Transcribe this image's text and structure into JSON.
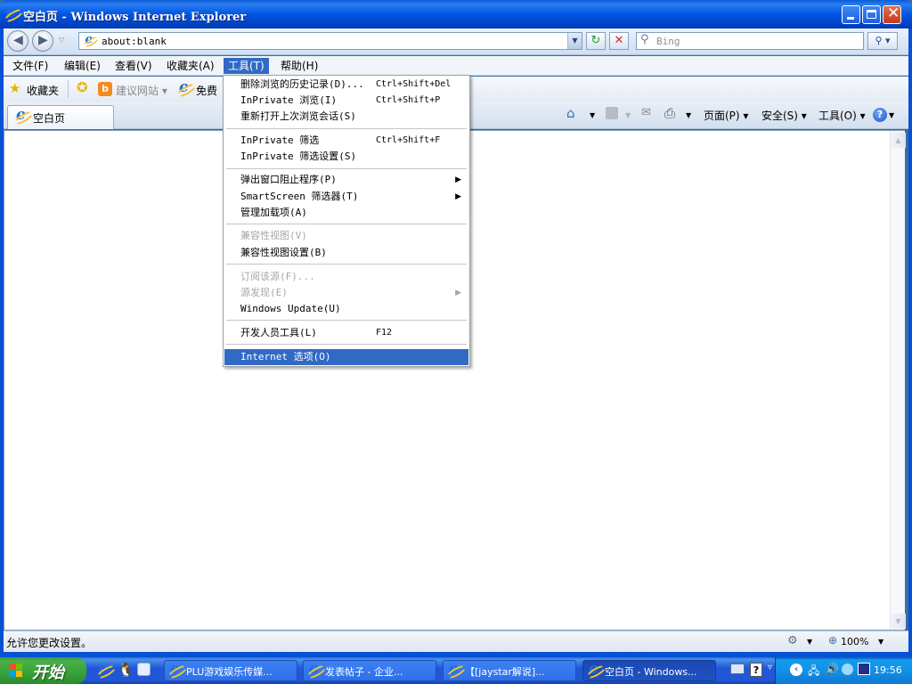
{
  "window": {
    "title": "空白页 - Windows Internet Explorer"
  },
  "navbar": {
    "address": "about:blank",
    "search_placeholder": "Bing"
  },
  "menubar": {
    "items": [
      "文件(F)",
      "编辑(E)",
      "查看(V)",
      "收藏夹(A)",
      "工具(T)",
      "帮助(H)"
    ],
    "active_index": 4
  },
  "favbar": {
    "favorites_label": "收藏夹",
    "suggested_sites": "建议网站 ▾",
    "free_label": "免费"
  },
  "tabbar": {
    "tab_title": "空白页",
    "page_label": "页面(P) ▾",
    "safety_label": "安全(S) ▾",
    "tools_label": "工具(O) ▾"
  },
  "tools_menu": {
    "items": [
      {
        "label": "删除浏览的历史记录(D)...",
        "shortcut": "Ctrl+Shift+Del"
      },
      {
        "label": "InPrivate 浏览(I)",
        "shortcut": "Ctrl+Shift+P"
      },
      {
        "label": "重新打开上次浏览会话(S)",
        "shortcut": ""
      },
      {
        "label": "InPrivate 筛选",
        "shortcut": "Ctrl+Shift+F"
      },
      {
        "label": "InPrivate 筛选设置(S)",
        "shortcut": ""
      },
      {
        "label": "弹出窗口阻止程序(P)",
        "shortcut": ""
      },
      {
        "label": "SmartScreen 筛选器(T)",
        "shortcut": ""
      },
      {
        "label": "管理加载项(A)",
        "shortcut": ""
      },
      {
        "label": "兼容性视图(V)",
        "shortcut": ""
      },
      {
        "label": "兼容性视图设置(B)",
        "shortcut": ""
      },
      {
        "label": "订阅该源(F)...",
        "shortcut": ""
      },
      {
        "label": "源发现(E)",
        "shortcut": ""
      },
      {
        "label": "Windows Update(U)",
        "shortcut": ""
      },
      {
        "label": "开发人员工具(L)",
        "shortcut": "F12"
      },
      {
        "label": "Internet 选项(O)",
        "shortcut": ""
      }
    ]
  },
  "statusbar": {
    "text": "允许您更改设置。",
    "zoom": "100%"
  },
  "taskbar": {
    "start_label": "开始",
    "tasks": [
      "PLU游戏娱乐传媒...",
      "发表帖子 - 企业...",
      "【[jaystar解说]...",
      "空白页 - Windows..."
    ],
    "clock": "19:56"
  },
  "colors": {
    "title_blue": "#0055e5",
    "menu_highlight": "#316ac5",
    "start_green": "#37a237",
    "taskbar_blue": "#2157d7"
  }
}
